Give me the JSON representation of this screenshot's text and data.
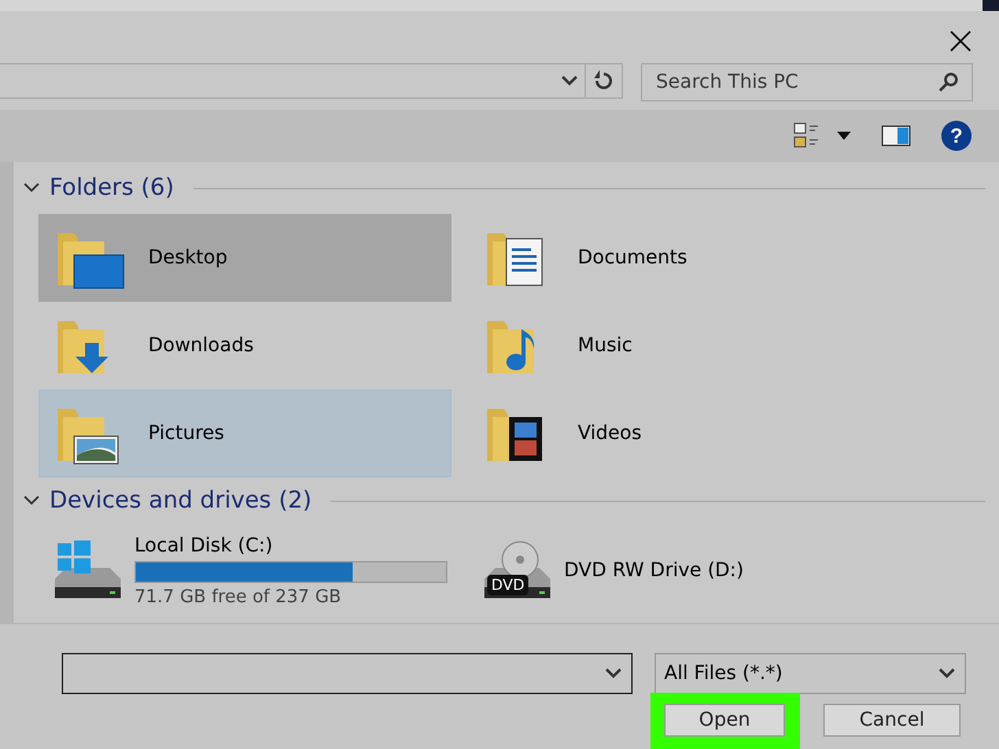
{
  "search": {
    "placeholder": "Search This PC"
  },
  "toolbar": {
    "help": "?"
  },
  "folders": {
    "title": "Folders (6)",
    "expanded": true,
    "items": [
      {
        "name": "Desktop",
        "kind": "desktop",
        "selected": true,
        "hovered": false
      },
      {
        "name": "Documents",
        "kind": "documents",
        "selected": false,
        "hovered": false
      },
      {
        "name": "Downloads",
        "kind": "downloads",
        "selected": false,
        "hovered": false
      },
      {
        "name": "Music",
        "kind": "music",
        "selected": false,
        "hovered": false
      },
      {
        "name": "Pictures",
        "kind": "pictures",
        "selected": false,
        "hovered": true
      },
      {
        "name": "Videos",
        "kind": "videos",
        "selected": false,
        "hovered": false
      }
    ]
  },
  "drives": {
    "title": "Devices and drives (2)",
    "expanded": true,
    "items": [
      {
        "name": "Local Disk (C:)",
        "kind": "disk",
        "level": 0.7,
        "free": "71.7 GB free of 237 GB"
      },
      {
        "name": "DVD RW Drive (D:)",
        "kind": "dvd",
        "badge": "DVD"
      }
    ]
  },
  "file_type": {
    "value": "All Files (*.*)"
  },
  "buttons": [
    {
      "label": "Open",
      "highlighted": true
    },
    {
      "label": "Cancel",
      "highlighted": false
    }
  ]
}
